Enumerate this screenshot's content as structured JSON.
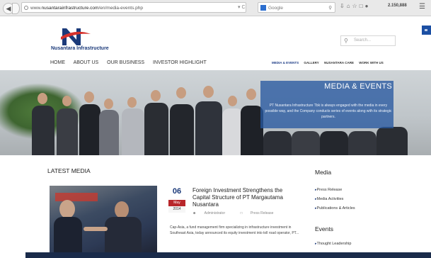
{
  "browser": {
    "url_prefix": "www.",
    "url_host": "nusantarainfrastructure.com",
    "url_path": "/en/media-events.php",
    "search_engine": "Google",
    "counter": "2.150,888"
  },
  "header": {
    "logo_text": "Nusantara Infrastructure",
    "search_placeholder": "Search..."
  },
  "main_nav": [
    "HOME",
    "ABOUT US",
    "OUR BUSINESS",
    "INVESTOR HIGHLIGHT"
  ],
  "sub_nav": [
    "MEDIA & EVENTS",
    "GALLERY",
    "NUSANTARA CARE",
    "WORK WITH US"
  ],
  "hero": {
    "title": "MEDIA & EVENTS",
    "description": "PT Nusantara Infrastructure Tbk is always engaged with the media in every possible way, and the Company conducts series of events along with its strategic partners."
  },
  "latest": {
    "title": "LATEST MEDIA",
    "article": {
      "day": "06",
      "month": "May",
      "year": "2014",
      "title": "Foreign Investment Strengthens the Capital Structure of PT Margautama Nusantara",
      "author": "Administrator",
      "category": "Press Release",
      "excerpt": "Cap-Asia, a fund management firm specializing in infrastructure investment in Southeast Asia, today announced its equity investment into toll road operator, PT..."
    }
  },
  "sidebar": {
    "media_title": "Media",
    "media_items": [
      "Press Release",
      "Media Activities",
      "Publications & Articles"
    ],
    "events_title": "Events",
    "events_items": [
      "Thought Leadership"
    ]
  },
  "colors": {
    "brand_navy": "#1b3a7a",
    "overlay_blue": "#2858a0",
    "date_red": "#b8262a"
  }
}
